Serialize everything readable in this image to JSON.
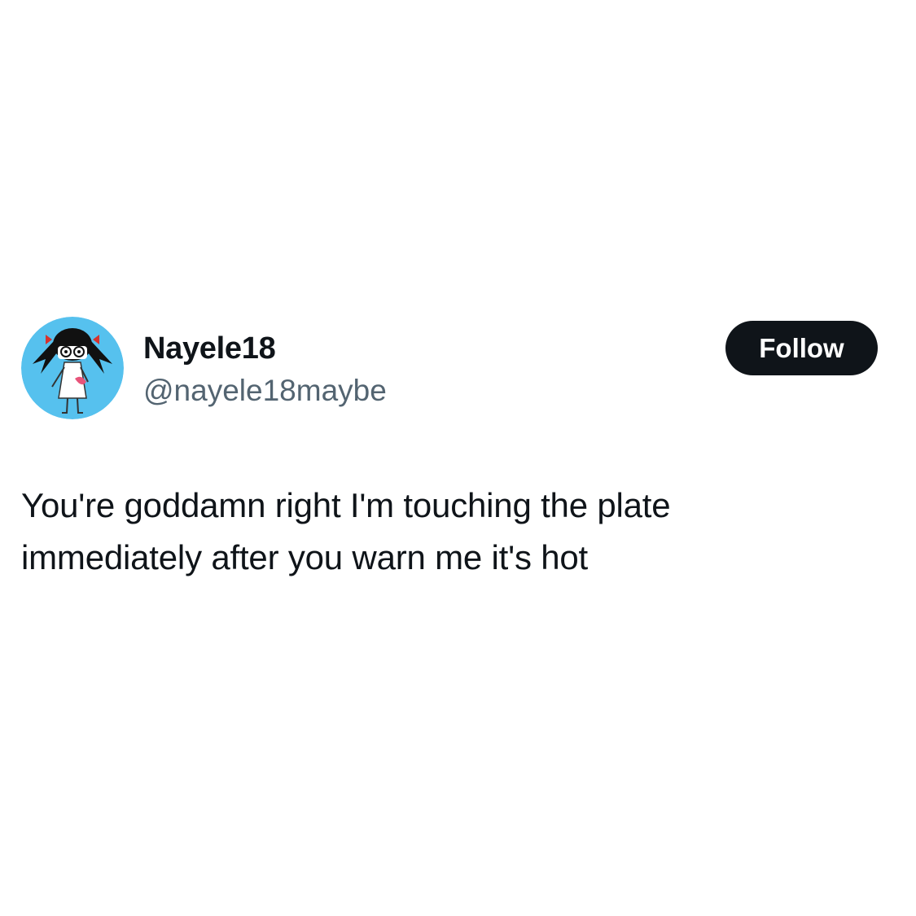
{
  "author": {
    "display_name": "Nayele18",
    "handle": "@nayele18maybe",
    "avatar_icon": "cartoon-girl-avatar-icon",
    "avatar_bg_color": "#56c1ee"
  },
  "actions": {
    "follow_label": "Follow",
    "follow_bg_color": "#0f1419"
  },
  "tweet": {
    "text_lines": [
      "You're goddamn right I'm touching the plate",
      "immediately after you warn me it's hot"
    ]
  }
}
